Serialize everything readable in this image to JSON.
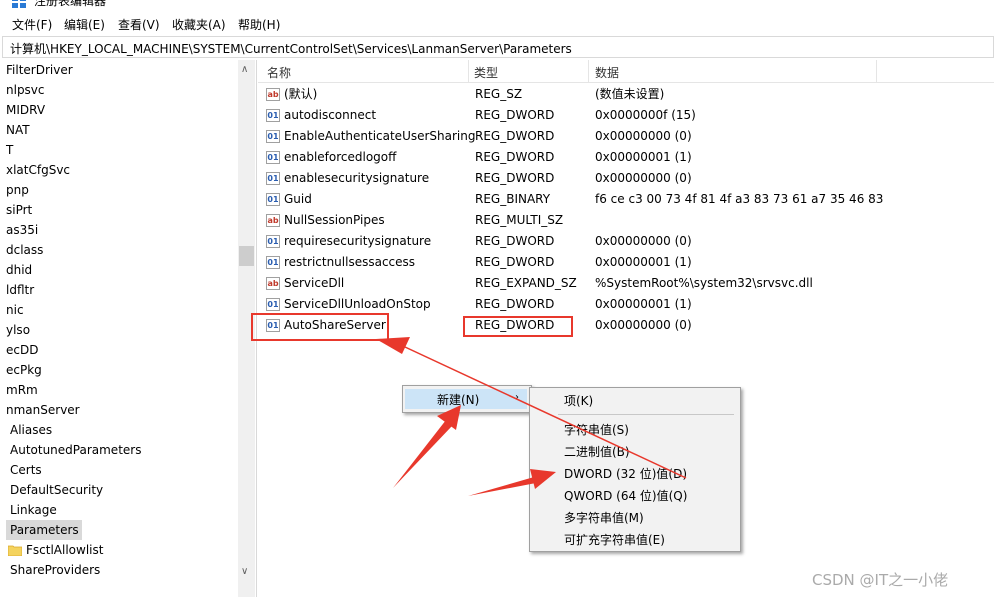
{
  "window": {
    "title": "注册表编辑器"
  },
  "menubar": {
    "items": [
      "文件(F)",
      "编辑(E)",
      "查看(V)",
      "收藏夹(A)",
      "帮助(H)"
    ]
  },
  "address": {
    "path": "计算机\\HKEY_LOCAL_MACHINE\\SYSTEM\\CurrentControlSet\\Services\\LanmanServer\\Parameters"
  },
  "tree": {
    "items": [
      "FilterDriver",
      "nlpsvc",
      "MIDRV",
      "NAT",
      "T",
      "xlatCfgSvc",
      "pnp",
      "siPrt",
      "as35i",
      "dclass",
      "dhid",
      "ldfltr",
      "nic",
      "ylso",
      "ecDD",
      "ecPkg",
      "mRm",
      "nmanServer",
      "Aliases",
      "AutotunedParameters",
      "Certs",
      "DefaultSecurity",
      "Linkage",
      "Parameters",
      "FsctlAllowlist",
      "ShareProviders"
    ],
    "selected": "Parameters"
  },
  "list": {
    "headers": {
      "name": "名称",
      "type": "类型",
      "data": "数据"
    },
    "rows": [
      {
        "name": "(默认)",
        "type": "REG_SZ",
        "data": "(数值未设置)",
        "icon": "string-value-icon"
      },
      {
        "name": "autodisconnect",
        "type": "REG_DWORD",
        "data": "0x0000000f (15)",
        "icon": "binary-value-icon"
      },
      {
        "name": "EnableAuthenticateUserSharing",
        "type": "REG_DWORD",
        "data": "0x00000000 (0)",
        "icon": "binary-value-icon"
      },
      {
        "name": "enableforcedlogoff",
        "type": "REG_DWORD",
        "data": "0x00000001 (1)",
        "icon": "binary-value-icon"
      },
      {
        "name": "enablesecuritysignature",
        "type": "REG_DWORD",
        "data": "0x00000000 (0)",
        "icon": "binary-value-icon"
      },
      {
        "name": "Guid",
        "type": "REG_BINARY",
        "data": "f6 ce c3 00 73 4f 81 4f a3 83 73 61 a7 35 46 83",
        "icon": "binary-value-icon"
      },
      {
        "name": "NullSessionPipes",
        "type": "REG_MULTI_SZ",
        "data": "",
        "icon": "string-value-icon"
      },
      {
        "name": "requiresecuritysignature",
        "type": "REG_DWORD",
        "data": "0x00000000 (0)",
        "icon": "binary-value-icon"
      },
      {
        "name": "restrictnullsessaccess",
        "type": "REG_DWORD",
        "data": "0x00000001 (1)",
        "icon": "binary-value-icon"
      },
      {
        "name": "ServiceDll",
        "type": "REG_EXPAND_SZ",
        "data": "%SystemRoot%\\system32\\srvsvc.dll",
        "icon": "string-value-icon"
      },
      {
        "name": "ServiceDllUnloadOnStop",
        "type": "REG_DWORD",
        "data": "0x00000001 (1)",
        "icon": "binary-value-icon"
      },
      {
        "name": "AutoShareServer",
        "type": "REG_DWORD",
        "data": "0x00000000 (0)",
        "icon": "binary-value-icon"
      }
    ]
  },
  "context_menu": {
    "new_label": "新建(N)"
  },
  "submenu": {
    "items": [
      "项(K)",
      "字符串值(S)",
      "二进制值(B)",
      "DWORD (32 位)值(D)",
      "QWORD (64 位)值(Q)",
      "多字符串值(M)",
      "可扩充字符串值(E)"
    ]
  },
  "watermark": "CSDN @IT之一小佬",
  "colors": {
    "highlight_red": "#e8382c",
    "selected_bg": "#d9d9d9",
    "menu_hover": "#cce4f7"
  }
}
